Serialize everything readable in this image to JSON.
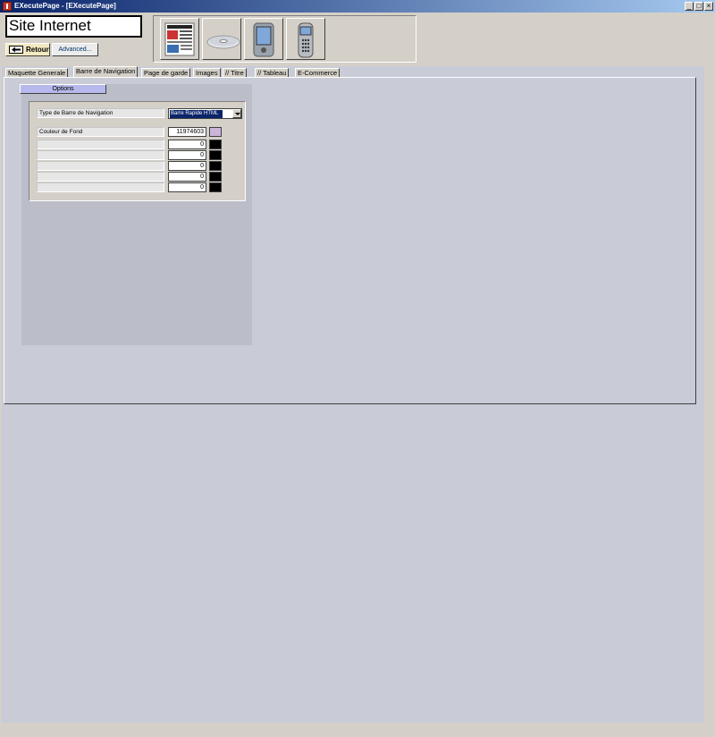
{
  "window": {
    "title": "EXecutePage - [EXecutePage]",
    "minimize": "_",
    "maximize": "□",
    "close": "×"
  },
  "header": {
    "site_title": "Site Internet",
    "retour_label": "Retour",
    "advanced_label": "Advanced..."
  },
  "icons": [
    {
      "name": "newspaper-page-icon"
    },
    {
      "name": "cd-disc-icon"
    },
    {
      "name": "pda-device-icon"
    },
    {
      "name": "mobile-phone-icon"
    }
  ],
  "tabs": [
    {
      "label": "Maquette Generale"
    },
    {
      "label": "Barre de Navigation",
      "active": true
    },
    {
      "label": "Page de garde"
    },
    {
      "label": "Images"
    },
    {
      "label": "// Titre"
    },
    {
      "label": "// Tableau"
    },
    {
      "label": "E-Commerce"
    }
  ],
  "options": {
    "button_label": "Options",
    "nav_type_label": "Type de Barre de Navigation",
    "nav_type_value": "Barre Rapide HTML",
    "bg_color_label": "Couleur de Fond",
    "bg_color_value": "11974603",
    "bg_color_swatch": "#cbb5d9",
    "rows": [
      {
        "value": "0",
        "color": "#000000"
      },
      {
        "value": "0",
        "color": "#000000"
      },
      {
        "value": "0",
        "color": "#000000"
      },
      {
        "value": "0",
        "color": "#000000"
      },
      {
        "value": "0",
        "color": "#000000"
      }
    ]
  }
}
